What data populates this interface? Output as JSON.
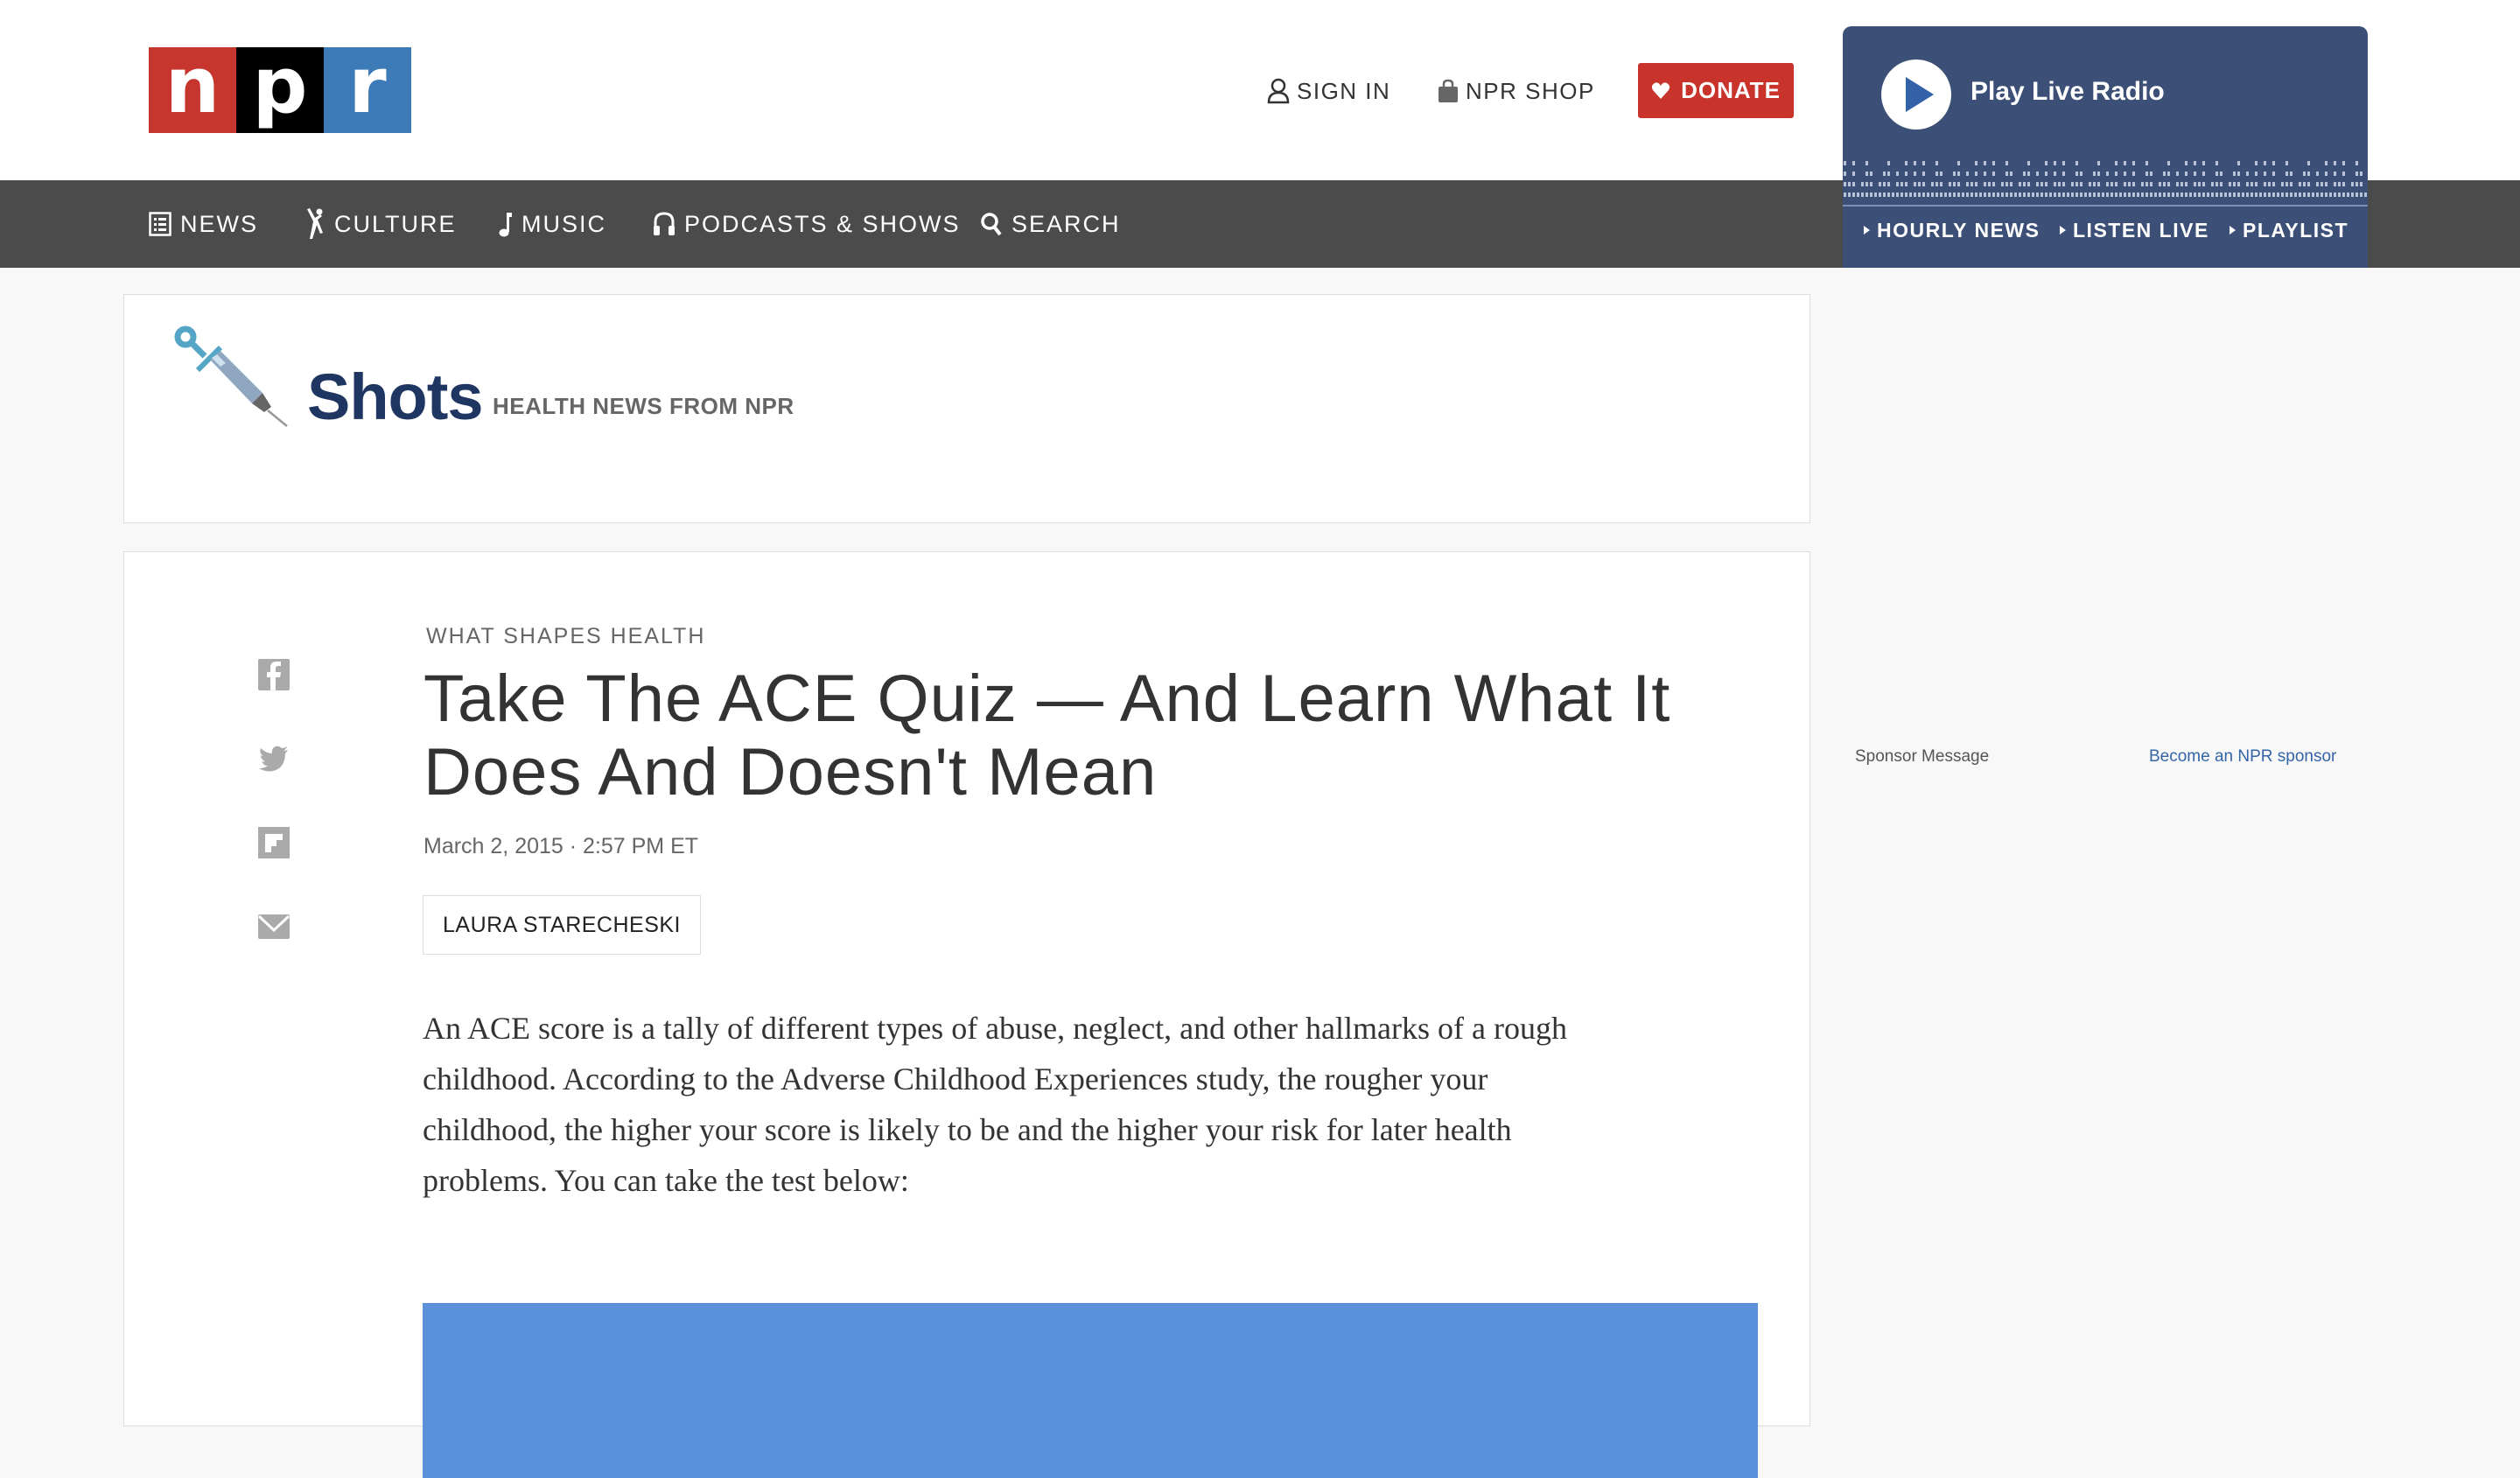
{
  "header": {
    "logo": {
      "letters": [
        "n",
        "p",
        "r"
      ],
      "colors": [
        "#c6352e",
        "#000000",
        "#3c7ab8"
      ]
    },
    "utility": [
      {
        "label": "SIGN IN",
        "icon": "user-icon"
      },
      {
        "label": "NPR SHOP",
        "icon": "shopping-bag-icon"
      }
    ],
    "donate": {
      "label": "DONATE",
      "icon": "heart-icon",
      "color": "#c8342c"
    }
  },
  "radio": {
    "play_label": "Play Live Radio",
    "links": [
      "HOURLY NEWS",
      "LISTEN LIVE",
      "PLAYLIST"
    ],
    "color": "#3c5077"
  },
  "nav": {
    "items": [
      {
        "label": "NEWS",
        "icon": "news-list-icon"
      },
      {
        "label": "CULTURE",
        "icon": "dancer-icon"
      },
      {
        "label": "MUSIC",
        "icon": "music-note-icon"
      },
      {
        "label": "PODCASTS & SHOWS",
        "icon": "headphones-icon"
      },
      {
        "label": "SEARCH",
        "icon": "search-icon"
      }
    ]
  },
  "blog": {
    "name": "Shots",
    "tagline": "HEALTH NEWS FROM NPR"
  },
  "article": {
    "slug": "WHAT SHAPES HEALTH",
    "headline": "Take The ACE Quiz — And Learn What It Does And Doesn't Mean",
    "date": "March 2, 2015 · 2:57 PM ET",
    "byline": "LAURA STARECHESKI",
    "body": "An ACE score is a tally of different types of abuse, neglect, and other hallmarks of a rough childhood. According to the Adverse Childhood Experiences study, the rougher your childhood, the higher your score is likely to be and the higher your risk for later health problems. You can take the test below:",
    "share": [
      "facebook-icon",
      "twitter-icon",
      "flipboard-icon",
      "email-icon"
    ],
    "embed_color": "#5b91da"
  },
  "sidebar": {
    "sponsor_label": "Sponsor Message",
    "sponsor_link": "Become an NPR sponsor"
  }
}
